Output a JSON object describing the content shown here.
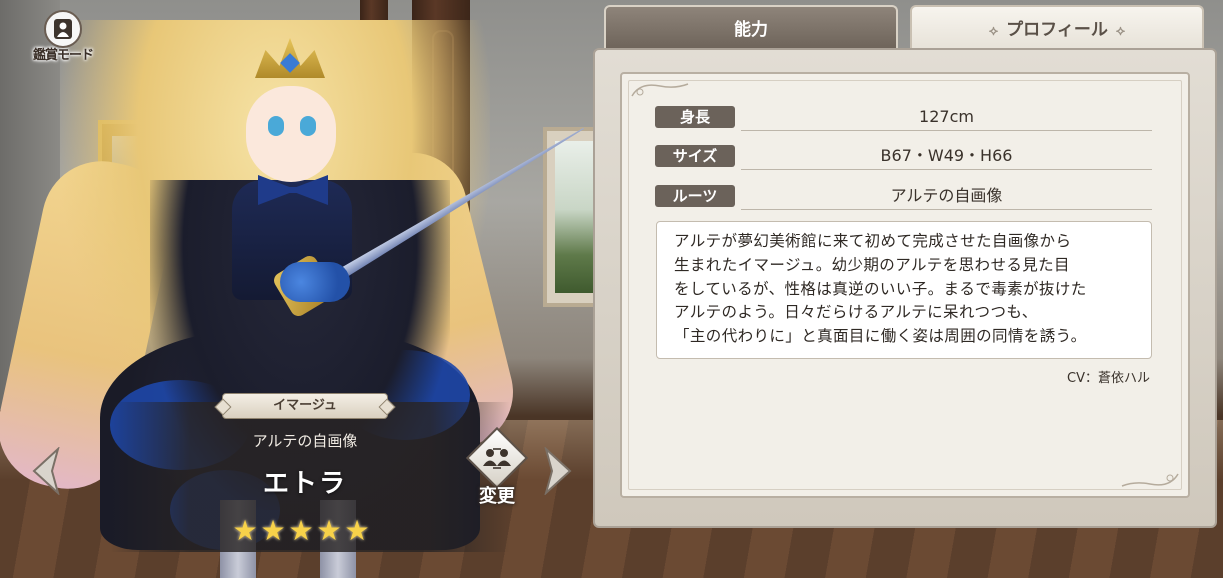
{
  "view_mode": {
    "label": "鑑賞モード"
  },
  "character": {
    "type_badge": "イマージュ",
    "subtitle": "アルテの自画像",
    "name": "エトラ",
    "rarity_stars": 5
  },
  "change_button": {
    "label": "変更"
  },
  "tabs": {
    "ability": "能力",
    "profile": "プロフィール",
    "active": "profile"
  },
  "profile": {
    "rows": [
      {
        "label": "身長",
        "value": "127cm"
      },
      {
        "label": "サイズ",
        "value": "B67・W49・H66"
      },
      {
        "label": "ルーツ",
        "value": "アルテの自画像"
      }
    ],
    "description_lines": [
      "アルテが夢幻美術館に来て初めて完成させた自画像から",
      "生まれたイマージュ。幼少期のアルテを思わせる見た目",
      "をしているが、性格は真逆のいい子。まるで毒素が抜けた",
      "アルテのよう。日々だらけるアルテに呆れつつも、",
      "「主の代わりに」と真面目に働く姿は周囲の同情を誘う。"
    ],
    "cv": "CV：蒼依ハル"
  },
  "colors": {
    "star": "#f7d24a",
    "label_bg": "#6b625a",
    "tab_active_bg": "#efebe4",
    "tab_inactive_bg": "#7c7268"
  }
}
